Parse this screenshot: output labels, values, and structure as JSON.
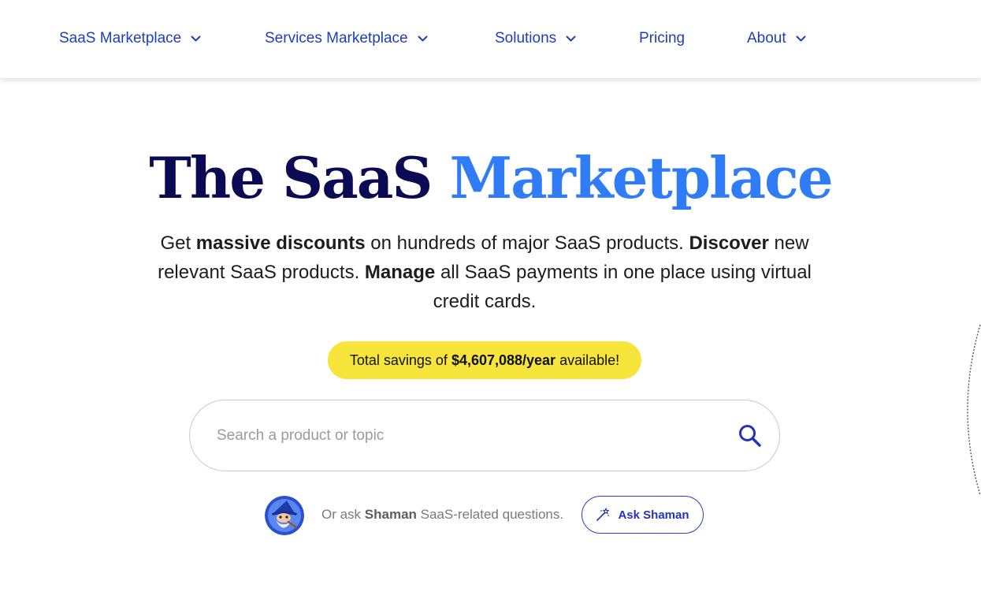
{
  "nav": {
    "items": [
      {
        "label": "SaaS Marketplace",
        "has_dropdown": true
      },
      {
        "label": "Services Marketplace",
        "has_dropdown": true
      },
      {
        "label": "Solutions",
        "has_dropdown": true
      },
      {
        "label": "Pricing",
        "has_dropdown": false
      },
      {
        "label": "About",
        "has_dropdown": true
      }
    ]
  },
  "hero": {
    "title_part1": "The SaaS",
    "title_part2": "Marketplace",
    "subtitle": {
      "s1": "Get ",
      "b1": "massive discounts",
      "s2": " on hundreds of major SaaS products. ",
      "b2": "Discover",
      "s3": " new relevant SaaS products. ",
      "b3": "Manage",
      "s4": " all SaaS payments in one place using virtual credit cards."
    }
  },
  "savings": {
    "prefix": "Total savings of",
    "amount": "$4,607,088/year",
    "suffix": "available!"
  },
  "search": {
    "placeholder": "Search a product or topic",
    "value": "",
    "icon": "search-icon"
  },
  "ask": {
    "text_prefix": "Or ask ",
    "name": "Shaman",
    "text_suffix": " SaaS-related questions.",
    "button_label": "Ask Shaman",
    "button_icon": "magic-wand-icon",
    "avatar": "wizard-avatar"
  },
  "colors": {
    "nav_link": "#1f3fb8",
    "title_dark": "#0c0a52",
    "title_accent": "#2f7cf6",
    "savings_bg": "#f8e53b",
    "ask_button": "#2434b8"
  }
}
